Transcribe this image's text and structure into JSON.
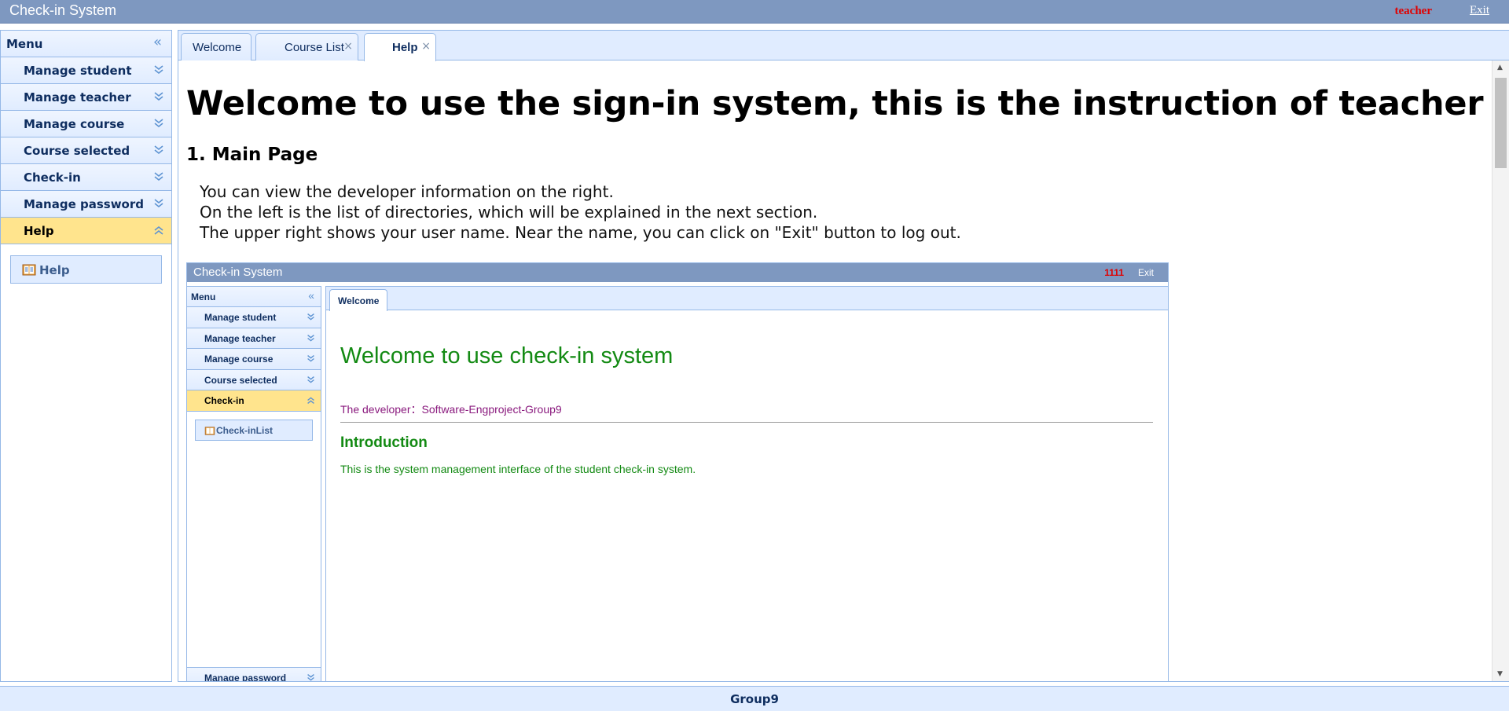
{
  "header": {
    "app_title": "Check-in System",
    "username": "teacher",
    "exit_label": "Exit"
  },
  "menu": {
    "title": "Menu",
    "items": [
      {
        "label": "Manage student"
      },
      {
        "label": "Manage teacher"
      },
      {
        "label": "Manage course"
      },
      {
        "label": "Course selected"
      },
      {
        "label": "Check-in"
      },
      {
        "label": "Manage password"
      },
      {
        "label": "Help"
      }
    ],
    "active_item": "Help",
    "submenu": [
      {
        "label": "Help",
        "icon": "book-icon"
      }
    ]
  },
  "tabs": [
    {
      "label": "Welcome",
      "closable": false
    },
    {
      "label": "Course List",
      "closable": true,
      "close": "×"
    },
    {
      "label": "Help",
      "closable": true,
      "close": "×",
      "active": true
    }
  ],
  "content": {
    "heading": "Welcome to use the sign-in system, this is the instruction of teacher page.",
    "section_title": "1. Main Page",
    "paragraphs": [
      "You can view the developer information on the right.",
      "On the left is the list of directories, which will be explained in the next section.",
      "The upper right shows your user name. Near the name, you can click on \"Exit\" button to log out."
    ]
  },
  "screenshot": {
    "app_title": "Check-in System",
    "username": "1111",
    "exit_label": "Exit",
    "menu_title": "Menu",
    "menu_items": [
      {
        "label": "Manage student"
      },
      {
        "label": "Manage teacher"
      },
      {
        "label": "Manage course"
      },
      {
        "label": "Course selected"
      },
      {
        "label": "Check-in"
      }
    ],
    "submenu_item": "Check-inList",
    "bottom_item": "Manage password",
    "tab_label": "Welcome",
    "welcome_title": "Welcome to use check-in system",
    "developer": "The developer：Software-Engproject-Group9",
    "intro_title": "Introduction",
    "intro_text": "This is the system management interface of the student check-in system."
  },
  "footer": {
    "text": "Group9"
  },
  "colors": {
    "header_bg": "#7e98c0",
    "panel_bg": "#e0ecff",
    "border": "#95b8e7",
    "active_item": "#ffe48d",
    "user_red": "#e00000",
    "welcome_green": "#138a13",
    "developer_purple": "#8a1a7e"
  }
}
